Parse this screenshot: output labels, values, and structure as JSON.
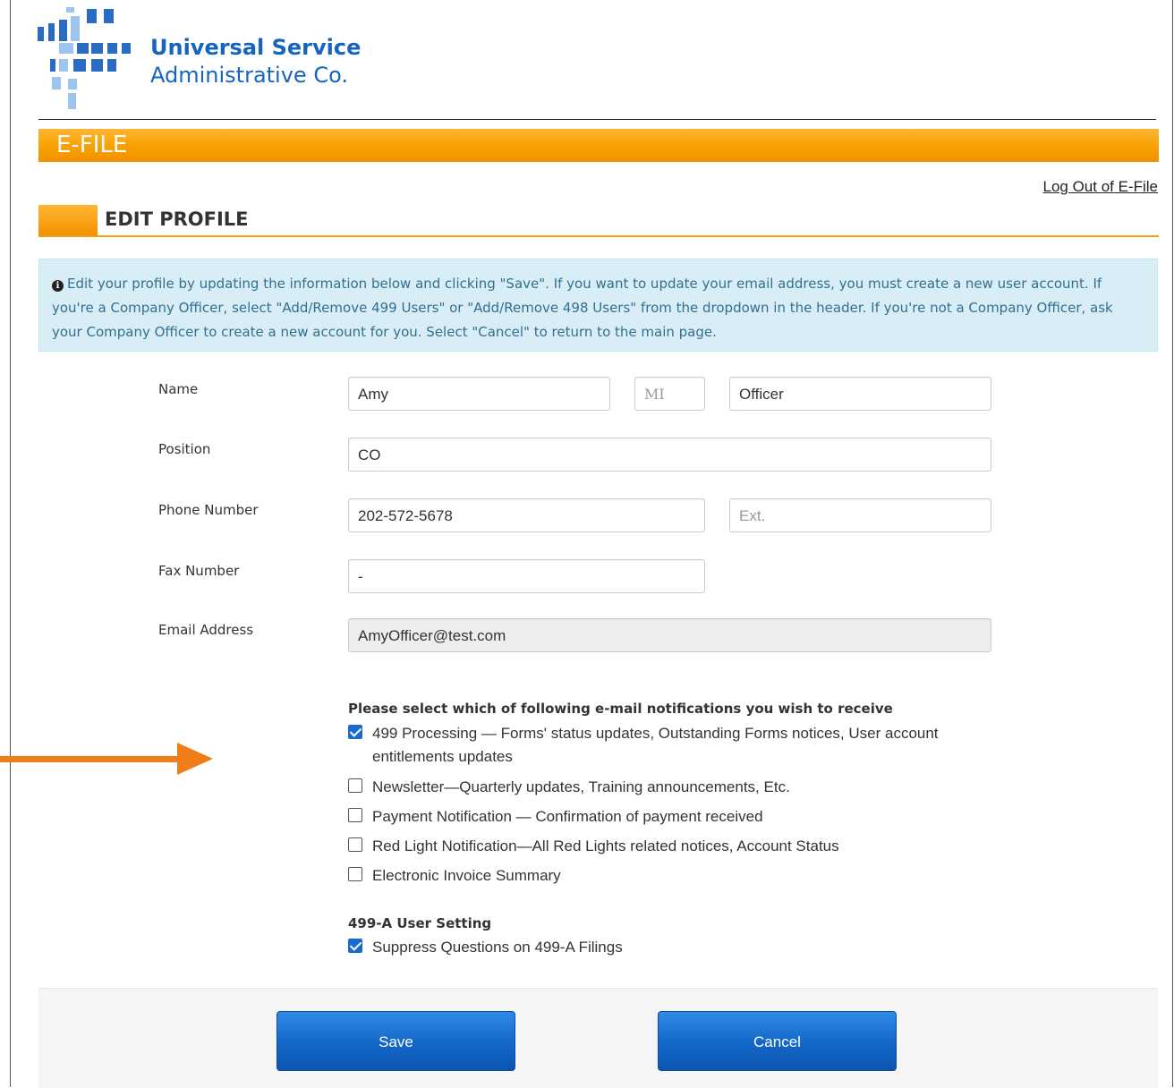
{
  "brand": {
    "line1": "Universal Service",
    "line2": "Administrative Co."
  },
  "app_title": "E-FILE",
  "logout_link": "Log Out of E-File",
  "section_title": "EDIT PROFILE",
  "info_text": "Edit your profile by updating the information below and clicking \"Save\". If you want to update your email address, you must create a new user account. If you're a Company Officer, select \"Add/Remove 499 Users\" or \"Add/Remove 498 Users\" from the dropdown in the header. If you're not a Company Officer, ask your Company Officer to create a new account for you. Select \"Cancel\" to return to the main page.",
  "form": {
    "name_label": "Name",
    "first_name": "Amy",
    "middle_initial_placeholder": "MI",
    "last_name": "Officer",
    "position_label": "Position",
    "position": "CO",
    "phone_label": "Phone Number",
    "phone": "202-572-5678",
    "ext_placeholder": "Ext.",
    "fax_label": "Fax Number",
    "fax": "-",
    "email_label": "Email Address",
    "email": "AmyOfficer@test.com"
  },
  "notifications": {
    "heading": "Please select which of following e-mail notifications you wish to receive",
    "items": [
      {
        "label": "499 Processing — Forms' status updates, Outstanding Forms notices, User account",
        "label_cont": "entitlements updates",
        "checked": true
      },
      {
        "label": "Newsletter—Quarterly updates, Training announcements, Etc.",
        "checked": false
      },
      {
        "label": "Payment Notification — Confirmation of payment received",
        "checked": false
      },
      {
        "label": "Red Light Notification—All Red Lights related notices, Account Status",
        "checked": false
      },
      {
        "label": "Electronic Invoice Summary",
        "checked": false
      }
    ]
  },
  "setting_499a": {
    "heading": "499-A User Setting",
    "label": "Suppress Questions on 499-A Filings",
    "checked": true
  },
  "buttons": {
    "save": "Save",
    "cancel": "Cancel"
  },
  "colors": {
    "brand_blue": "#1565c0",
    "orange": "#f7a100",
    "button_blue": "#1366c7",
    "info_bg": "#d9edf7",
    "arrow": "#f07d1a"
  }
}
